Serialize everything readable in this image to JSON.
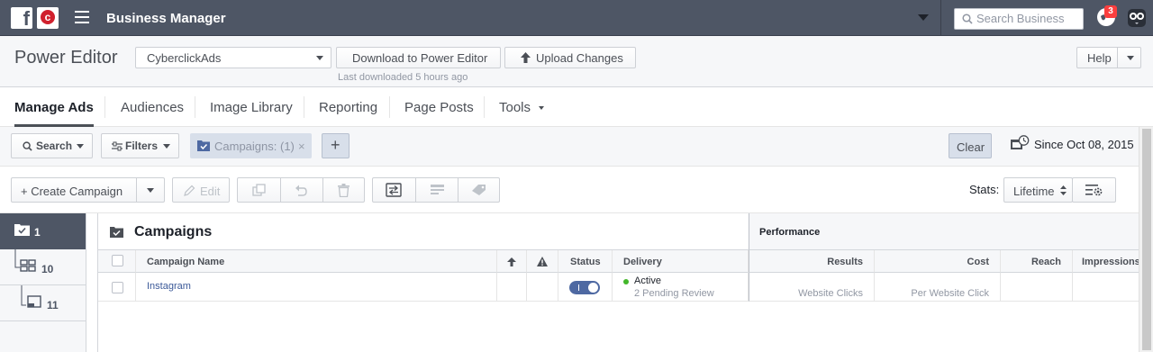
{
  "topbar": {
    "fb_logo": "f",
    "cc_logo": "c",
    "title": "Business Manager",
    "search_placeholder": "Search Business",
    "notification_count": "3"
  },
  "power_editor": {
    "title": "Power Editor",
    "account_selected": "CyberclickAds",
    "download_label": "Download to Power Editor",
    "upload_label": "Upload Changes",
    "last_downloaded": "Last downloaded 5 hours ago",
    "help_label": "Help"
  },
  "nav": {
    "tabs": [
      {
        "label": "Manage Ads"
      },
      {
        "label": "Audiences"
      },
      {
        "label": "Image Library"
      },
      {
        "label": "Reporting"
      },
      {
        "label": "Page Posts"
      },
      {
        "label": "Tools"
      }
    ]
  },
  "filters": {
    "search_label": "Search",
    "filters_label": "Filters",
    "chip_label": "Campaigns:",
    "chip_count": "(1)",
    "chip_close": "×",
    "add_label": "+",
    "clear_label": "Clear",
    "since_label": "Since Oct 08, 2015"
  },
  "toolbar": {
    "create_label": "+ Create Campaign",
    "edit_label": "Edit",
    "stats_label": "Stats:",
    "lifetime_label": "Lifetime"
  },
  "levels": [
    {
      "count": "1"
    },
    {
      "count": "10"
    },
    {
      "count": "11"
    }
  ],
  "table": {
    "section_title": "Campaigns",
    "performance_title": "Performance",
    "headers": {
      "campaign_name": "Campaign Name",
      "status": "Status",
      "delivery": "Delivery",
      "results": "Results",
      "cost": "Cost",
      "reach": "Reach",
      "impressions": "Impressions"
    },
    "rows": [
      {
        "campaign_name": "Instagram",
        "delivery_status": "Active",
        "delivery_sub": "2 Pending Review",
        "results_sub": "Website Clicks",
        "cost_sub": "Per Website Click"
      }
    ]
  },
  "colors": {
    "topbar": "#4e5665",
    "link": "#3b5998",
    "active_green": "#42b72a",
    "toggle_on": "#4e69a2",
    "badge": "#fa3e3e"
  }
}
